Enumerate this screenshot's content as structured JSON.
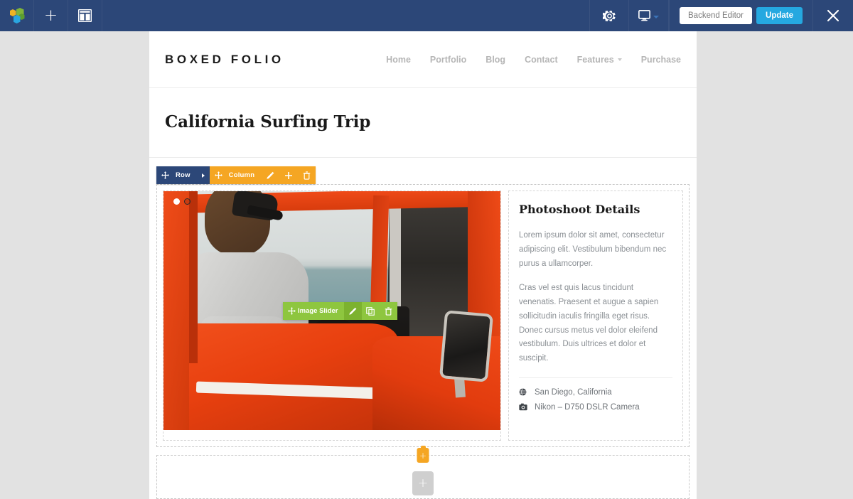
{
  "admin_bar": {
    "logo_icon": "visual-composer-cubes-logo",
    "add_element_icon": "plus-icon",
    "templates_icon": "layout-grid-icon",
    "settings_icon": "gear-icon",
    "responsive_icon": "monitor-icon",
    "responsive_caret_icon": "chevron-down-icon",
    "backend_editor_label": "Backend Editor",
    "update_label": "Update",
    "close_icon": "close-x-icon",
    "bar_color": "#2c4778",
    "update_color": "#25a8e0"
  },
  "site": {
    "brand": "BOXED FOLIO",
    "nav": [
      {
        "label": "Home",
        "has_caret": false
      },
      {
        "label": "Portfolio",
        "has_caret": false
      },
      {
        "label": "Blog",
        "has_caret": false
      },
      {
        "label": "Contact",
        "has_caret": false
      },
      {
        "label": "Features",
        "has_caret": true
      },
      {
        "label": "Purchase",
        "has_caret": false
      }
    ]
  },
  "post": {
    "title": "California Surfing Trip"
  },
  "builder": {
    "row_controls": {
      "move_icon": "move-arrows-icon",
      "row_label": "Row",
      "expand_icon": "chevron-right-icon",
      "color": "#2c4778"
    },
    "column_controls": {
      "move_icon": "move-arrows-icon",
      "column_label": "Column",
      "edit_icon": "pencil-icon",
      "add_icon": "plus-icon",
      "delete_icon": "trash-icon",
      "color": "#f5a623"
    },
    "element_controls": {
      "move_icon": "move-arrows-icon",
      "element_label": "Image Slider",
      "edit_icon": "pencil-icon",
      "clone_icon": "copy-icon",
      "delete_icon": "trash-icon",
      "color": "#8ec63f"
    },
    "add_row_badge_icon": "plus-icon",
    "add_element_placeholder_icon": "plus-icon"
  },
  "slider": {
    "dots": [
      {
        "state": "active"
      },
      {
        "state": "idle"
      }
    ]
  },
  "details": {
    "heading": "Photoshoot Details",
    "paragraphs": [
      "Lorem ipsum dolor sit amet, consectetur adipiscing elit. Vestibulum bibendum nec purus a ullamcorper.",
      "Cras vel est quis lacus tincidunt venenatis. Praesent et augue a sapien sollicitudin iaculis fringilla eget risus. Donec cursus metus vel dolor eleifend vestibulum. Duis ultrices et dolor et suscipit."
    ],
    "meta": [
      {
        "icon": "location-globe-icon",
        "text": "San Diego, California"
      },
      {
        "icon": "camera-icon",
        "text": "Nikon – D750 DSLR Camera"
      }
    ]
  }
}
